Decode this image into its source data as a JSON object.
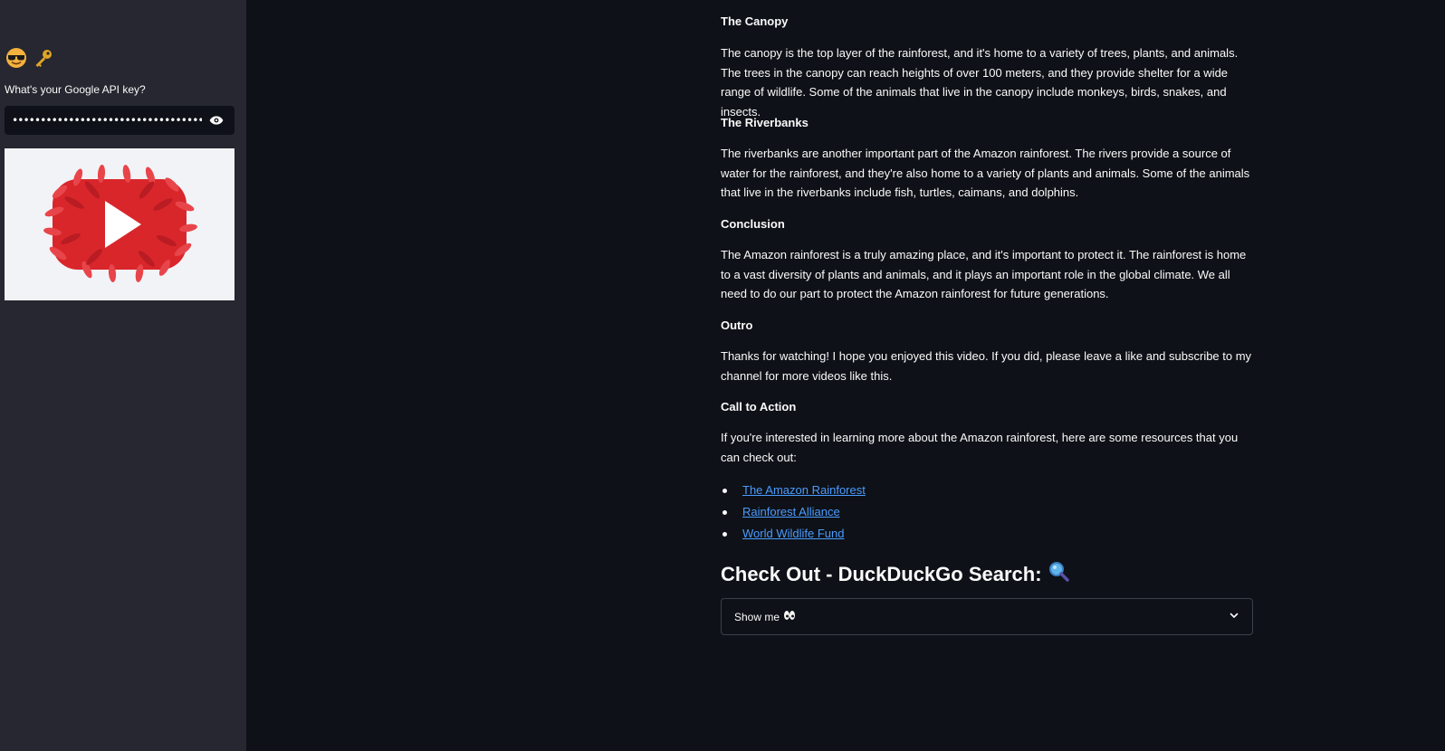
{
  "sidebar": {
    "emoji_1": "sunglasses-face-icon",
    "emoji_2": "key-icon",
    "api_label": "What's your Google API key?",
    "api_value": "••••••••••••••••••••••••••••••••••••••••",
    "image": "youtube-logo-made-of-red-leaves"
  },
  "main": {
    "sections": [
      {
        "heading": "The Canopy",
        "text": "The canopy is the top layer of the rainforest, and it's home to a variety of trees, plants, and animals. The trees in the canopy can reach heights of over 100 meters, and they provide shelter for a wide range of wildlife. Some of the animals that live in the canopy include monkeys, birds, snakes, and insects."
      },
      {
        "heading": "The Riverbanks",
        "text": "The riverbanks are another important part of the Amazon rainforest. The rivers provide a source of water for the rainforest, and they're also home to a variety of plants and animals. Some of the animals that live in the riverbanks include fish, turtles, caimans, and dolphins."
      },
      {
        "heading": "Conclusion",
        "text": "The Amazon rainforest is a truly amazing place, and it's important to protect it. The rainforest is home to a vast diversity of plants and animals, and it plays an important role in the global climate. We all need to do our part to protect the Amazon rainforest for future generations."
      },
      {
        "heading": "Outro",
        "text": "Thanks for watching! I hope you enjoyed this video. If you did, please leave a like and subscribe to my channel for more videos like this."
      },
      {
        "heading": "Call to Action",
        "text": "If you're interested in learning more about the Amazon rainforest, here are some resources that you can check out:"
      }
    ],
    "links": [
      "The Amazon Rainforest",
      "Rainforest Alliance",
      "World Wildlife Fund"
    ],
    "search_title": "Check Out - DuckDuckGo Search:",
    "search_icon": "magnifying-glass-icon",
    "expander_label": "Show me",
    "expander_icon": "eyes-icon",
    "colors": {
      "background": "#0e1117",
      "sidebar": "#262730",
      "link": "#4a9cff"
    }
  }
}
